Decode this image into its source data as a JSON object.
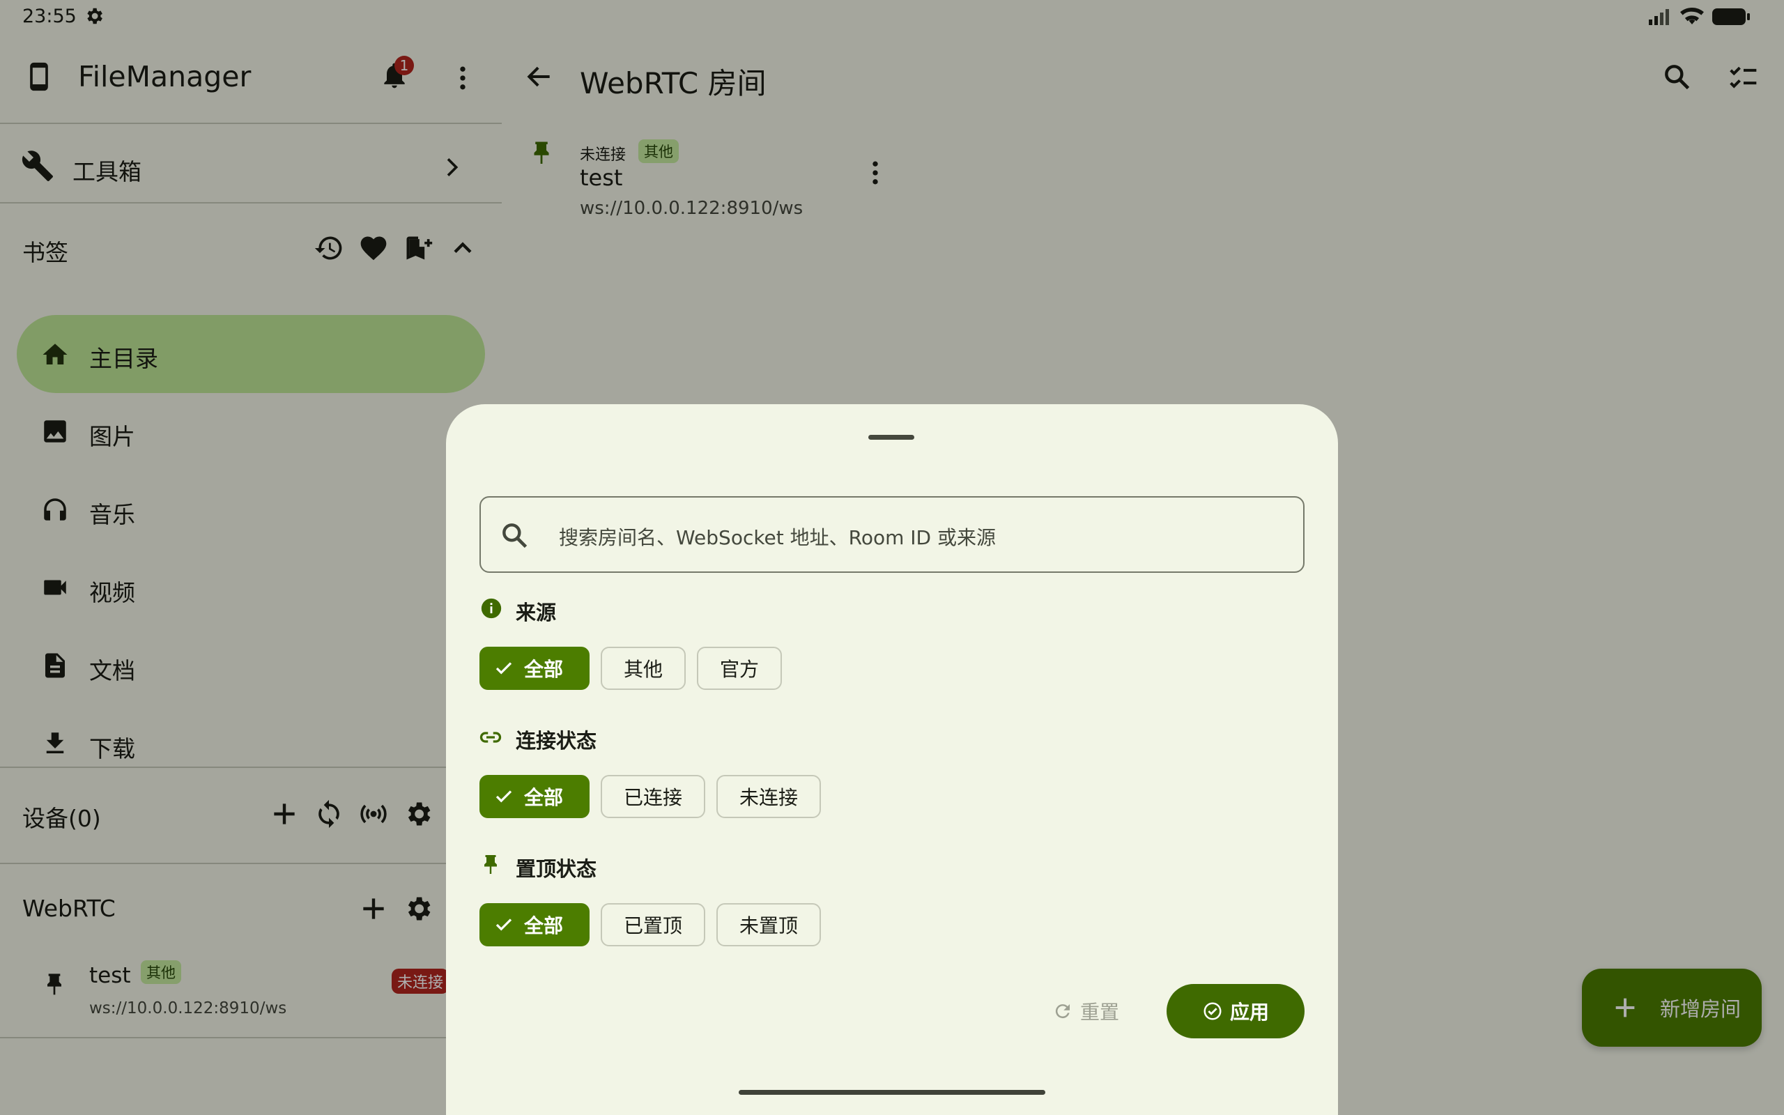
{
  "status_bar": {
    "time": "23:55"
  },
  "drawer": {
    "app_title": "FileManager",
    "notification_count": "1",
    "toolbox_label": "工具箱",
    "bookmarks_title": "书签",
    "nav_items": [
      {
        "label": "主目录",
        "icon": "home-icon",
        "selected": true
      },
      {
        "label": "图片",
        "icon": "image-icon"
      },
      {
        "label": "音乐",
        "icon": "headphones-icon"
      },
      {
        "label": "视频",
        "icon": "videocam-icon"
      },
      {
        "label": "文档",
        "icon": "document-icon"
      },
      {
        "label": "下载",
        "icon": "download-icon"
      }
    ],
    "devices_title": "设备(0)",
    "webrtc_title": "WebRTC",
    "webrtc_room": {
      "name": "test",
      "tag": "其他",
      "url": "ws://10.0.0.122:8910/ws",
      "status": "未连接"
    }
  },
  "main": {
    "title": "WebRTC 房间",
    "room": {
      "status": "未连接",
      "tag": "其他",
      "name": "test",
      "url": "ws://10.0.0.122:8910/ws"
    }
  },
  "sheet": {
    "search_placeholder": "搜索房间名、WebSocket 地址、Room ID 或来源",
    "sections": [
      {
        "title": "来源",
        "icon": "info-icon",
        "chips": [
          "全部",
          "其他",
          "官方"
        ],
        "selected": 0
      },
      {
        "title": "连接状态",
        "icon": "link-icon",
        "chips": [
          "全部",
          "已连接",
          "未连接"
        ],
        "selected": 0
      },
      {
        "title": "置顶状态",
        "icon": "pin-icon",
        "chips": [
          "全部",
          "已置顶",
          "未置顶"
        ],
        "selected": 0
      }
    ],
    "reset_label": "重置",
    "apply_label": "应用"
  },
  "fab": {
    "label": "新增房间"
  },
  "colors": {
    "accent": "#4c7d00",
    "selected_nav": "#bfe697",
    "badge_red": "#b3261e",
    "sheet_bg": "#f2f5e6"
  }
}
